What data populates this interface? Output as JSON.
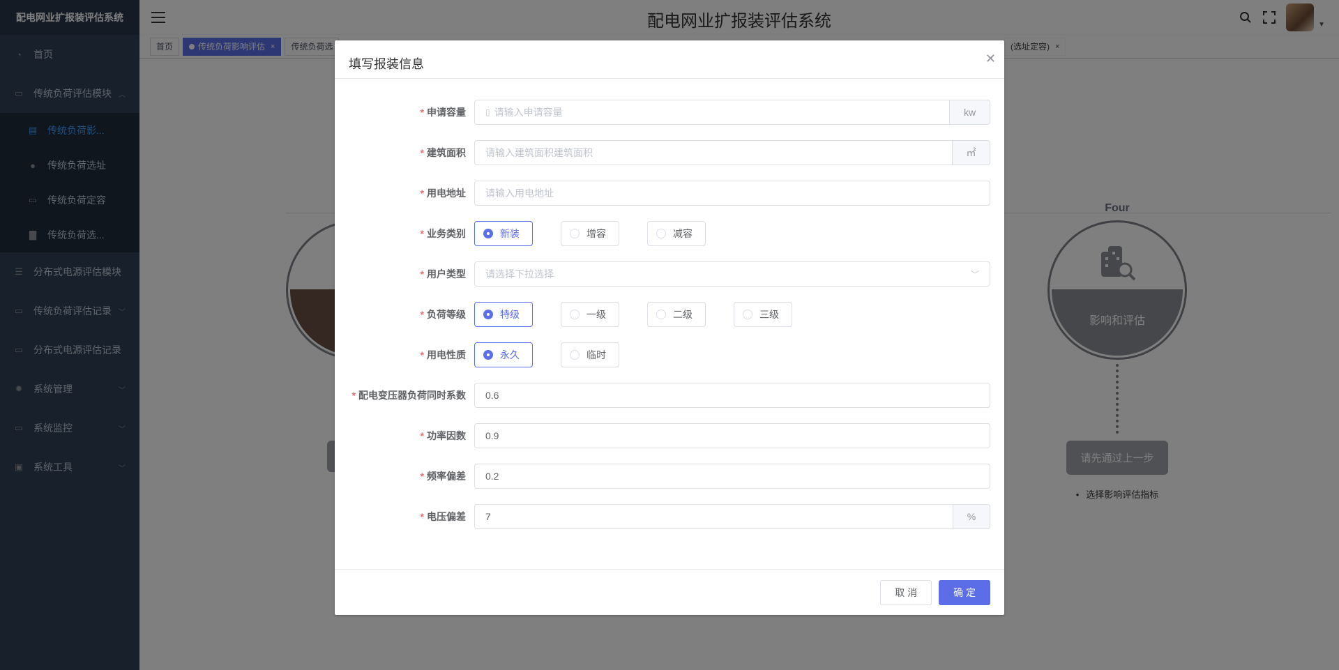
{
  "app": {
    "sidebar_title": "配电网业扩报装评估系统",
    "header_title": "配电网业扩报装评估系统"
  },
  "sidebar": {
    "items": [
      {
        "label": "首页",
        "icon": "dashboard-icon"
      },
      {
        "label": "传统负荷评估模块",
        "icon": "monitor-icon"
      },
      {
        "label": "分布式电源评估模块",
        "icon": "list-icon"
      },
      {
        "label": "传统负荷评估记录",
        "icon": "monitor-icon"
      },
      {
        "label": "分布式电源评估记录",
        "icon": "monitor-icon"
      },
      {
        "label": "系统管理",
        "icon": "gear-icon"
      },
      {
        "label": "系统监控",
        "icon": "monitor-icon"
      },
      {
        "label": "系统工具",
        "icon": "toolbox-icon"
      }
    ],
    "submenu": [
      {
        "label": "传统负荷影...",
        "active": true
      },
      {
        "label": "传统负荷选址"
      },
      {
        "label": "传统负荷定容"
      },
      {
        "label": "传统负荷选..."
      }
    ]
  },
  "tags": [
    {
      "label": "首页"
    },
    {
      "label": "传统负荷影响评估",
      "active": true
    },
    {
      "label": "传统负荷选"
    },
    {
      "label": "(选址定容)"
    }
  ],
  "background": {
    "step4_label": "Four",
    "step4_text": "影响和评估",
    "step4_button": "请先通过上一步",
    "step4_bullet": "选择影响评估指标"
  },
  "dialog": {
    "title": "填写报装信息",
    "fields": {
      "capacity": {
        "label": "申请容量",
        "placeholder": "请输入申请容量",
        "unit": "kw"
      },
      "area": {
        "label": "建筑面积",
        "placeholder": "请输入建筑面积建筑面积",
        "unit": "㎡"
      },
      "address": {
        "label": "用电地址",
        "placeholder": "请输入用电地址"
      },
      "business": {
        "label": "业务类别",
        "options": [
          "新装",
          "增容",
          "减容"
        ],
        "selected": "新装"
      },
      "user_type": {
        "label": "用户类型",
        "placeholder": "请选择下拉选择"
      },
      "load_level": {
        "label": "负荷等级",
        "options": [
          "特级",
          "一级",
          "二级",
          "三级"
        ],
        "selected": "特级"
      },
      "nature": {
        "label": "用电性质",
        "options": [
          "永久",
          "临时"
        ],
        "selected": "永久"
      },
      "coefficient": {
        "label": "配电变压器负荷同时系数",
        "value": "0.6"
      },
      "power_factor": {
        "label": "功率因数",
        "value": "0.9"
      },
      "freq_dev": {
        "label": "频率偏差",
        "value": "0.2"
      },
      "volt_dev": {
        "label": "电压偏差",
        "value": "7",
        "unit": "%"
      }
    },
    "cancel": "取 消",
    "confirm": "确 定"
  },
  "colors": {
    "sidebar_bg": "#304156",
    "primary": "#5b6ee8",
    "required": "#f56c6c"
  }
}
